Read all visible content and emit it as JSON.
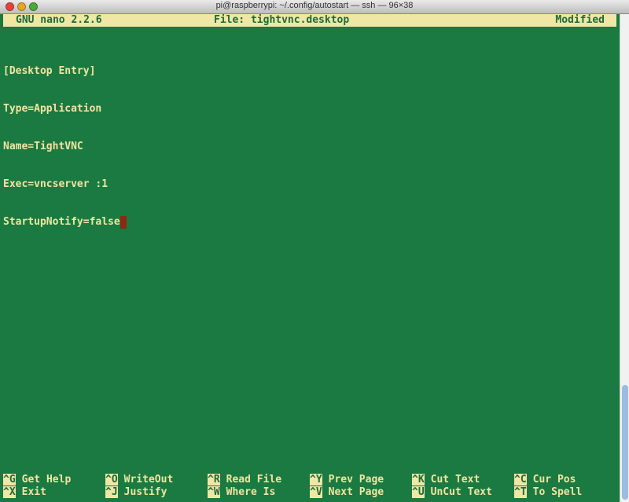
{
  "window": {
    "title": "pi@raspberrypi: ~/.config/autostart — ssh — 96×38"
  },
  "nano": {
    "version": "GNU nano 2.2.6",
    "file": "File: tightvnc.desktop",
    "status": "Modified"
  },
  "editor": {
    "lines": [
      "[Desktop Entry]",
      "Type=Application",
      "Name=TightVNC",
      "Exec=vncserver :1",
      "StartupNotify=false"
    ]
  },
  "shortcuts": {
    "row1": [
      {
        "key": "^G",
        "label": "Get Help"
      },
      {
        "key": "^O",
        "label": "WriteOut"
      },
      {
        "key": "^R",
        "label": "Read File"
      },
      {
        "key": "^Y",
        "label": "Prev Page"
      },
      {
        "key": "^K",
        "label": "Cut Text"
      },
      {
        "key": "^C",
        "label": "Cur Pos"
      }
    ],
    "row2": [
      {
        "key": "^X",
        "label": "Exit"
      },
      {
        "key": "^J",
        "label": "Justify"
      },
      {
        "key": "^W",
        "label": "Where Is"
      },
      {
        "key": "^V",
        "label": "Next Page"
      },
      {
        "key": "^U",
        "label": "UnCut Text"
      },
      {
        "key": "^T",
        "label": "To Spell"
      }
    ]
  },
  "colors": {
    "terminal_bg": "#1a7a41",
    "text": "#f1e5a2",
    "cursor": "#8b2a10",
    "highlight": "#f0e7a5"
  }
}
